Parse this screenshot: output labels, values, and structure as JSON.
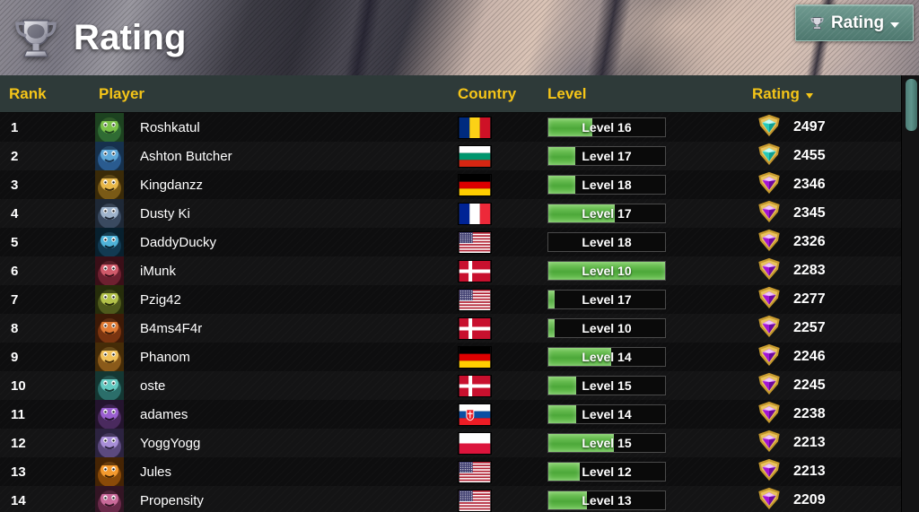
{
  "banner": {
    "title": "Rating",
    "trophy_icon": "trophy-icon"
  },
  "dropdown": {
    "label": "Rating",
    "icon": "trophy-icon",
    "caret": "chevron-down-icon",
    "accent_color": "#5d8a80"
  },
  "columns": {
    "rank": "Rank",
    "player": "Player",
    "country": "Country",
    "level": "Level",
    "rating": "Rating",
    "sort_caret": "chevron-down-icon",
    "header_color": "#f5c518",
    "header_bg": "#2e3a39"
  },
  "rows": [
    {
      "rank": "1",
      "player": "Roshkatul",
      "country": "Romania",
      "flag": "ro",
      "level": "Level 16",
      "level_pct": 38,
      "rating": "2497",
      "gem": "diamond-cyan"
    },
    {
      "rank": "2",
      "player": "Ashton Butcher",
      "country": "Bulgaria",
      "flag": "bg",
      "level": "Level 17",
      "level_pct": 23,
      "rating": "2455",
      "gem": "diamond-cyan"
    },
    {
      "rank": "3",
      "player": "Kingdanzz",
      "country": "Germany",
      "flag": "de",
      "level": "Level 18",
      "level_pct": 23,
      "rating": "2346",
      "gem": "diamond-purple"
    },
    {
      "rank": "4",
      "player": "Dusty Ki",
      "country": "France",
      "flag": "fr",
      "level": "Level 17",
      "level_pct": 57,
      "rating": "2345",
      "gem": "diamond-purple"
    },
    {
      "rank": "5",
      "player": "DaddyDucky",
      "country": "USA",
      "flag": "us",
      "level": "Level 18",
      "level_pct": 0,
      "rating": "2326",
      "gem": "diamond-purple"
    },
    {
      "rank": "6",
      "player": "iMunk",
      "country": "Denmark",
      "flag": "dk",
      "level": "Level 10",
      "level_pct": 100,
      "rating": "2283",
      "gem": "diamond-purple"
    },
    {
      "rank": "7",
      "player": "Pzig42",
      "country": "USA",
      "flag": "us",
      "level": "Level 17",
      "level_pct": 5,
      "rating": "2277",
      "gem": "diamond-purple"
    },
    {
      "rank": "8",
      "player": "B4ms4F4r",
      "country": "Denmark",
      "flag": "dk",
      "level": "Level 10",
      "level_pct": 5,
      "rating": "2257",
      "gem": "diamond-purple"
    },
    {
      "rank": "9",
      "player": "Phanom",
      "country": "Germany",
      "flag": "de",
      "level": "Level 14",
      "level_pct": 54,
      "rating": "2246",
      "gem": "diamond-purple"
    },
    {
      "rank": "10",
      "player": "oste",
      "country": "Denmark",
      "flag": "dk",
      "level": "Level 15",
      "level_pct": 24,
      "rating": "2245",
      "gem": "diamond-purple"
    },
    {
      "rank": "11",
      "player": "adames",
      "country": "Slovakia",
      "flag": "sk",
      "level": "Level 14",
      "level_pct": 24,
      "rating": "2238",
      "gem": "diamond-purple"
    },
    {
      "rank": "12",
      "player": "YoggYogg",
      "country": "Poland",
      "flag": "pl",
      "level": "Level 15",
      "level_pct": 56,
      "rating": "2213",
      "gem": "diamond-purple"
    },
    {
      "rank": "13",
      "player": "Jules",
      "country": "USA",
      "flag": "us",
      "level": "Level 12",
      "level_pct": 27,
      "rating": "2213",
      "gem": "diamond-purple"
    },
    {
      "rank": "14",
      "player": "Propensity",
      "country": "USA",
      "flag": "us",
      "level": "Level 13",
      "level_pct": 33,
      "rating": "2209",
      "gem": "diamond-purple"
    }
  ],
  "scrollbar": {
    "thumb_color": "#5f948c"
  }
}
